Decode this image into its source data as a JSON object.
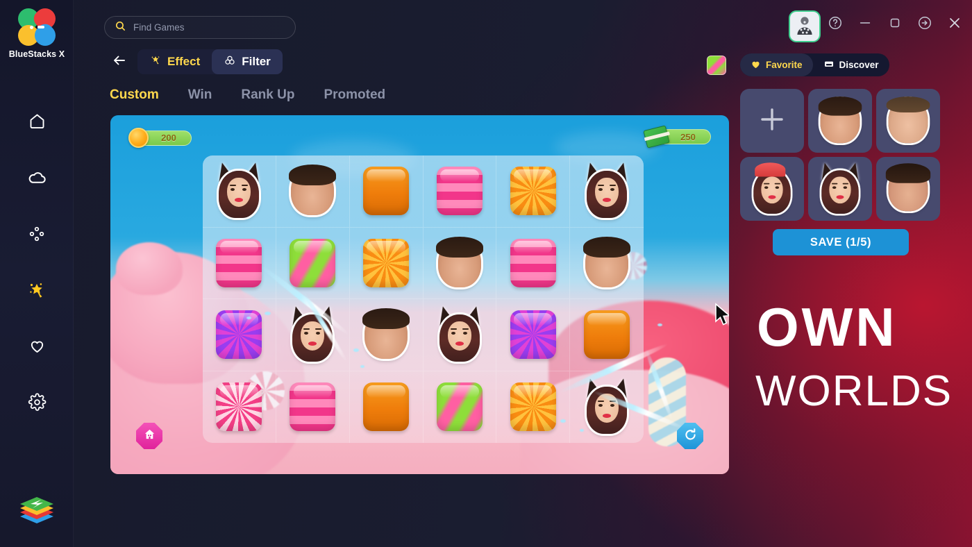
{
  "app": {
    "brand_name": "BlueStacks X",
    "logo_icon": "bluestacks-petals-logo"
  },
  "search": {
    "placeholder": "Find Games",
    "value": "",
    "icon": "search-icon"
  },
  "window_controls": [
    {
      "name": "help-button",
      "icon": "question-circle-icon"
    },
    {
      "name": "minimize-button",
      "icon": "minimize-icon"
    },
    {
      "name": "maximize-button",
      "icon": "maximize-square-icon"
    },
    {
      "name": "popout-button",
      "icon": "arrow-right-circle-icon"
    },
    {
      "name": "close-button",
      "icon": "close-x-icon"
    }
  ],
  "profile": {
    "name": "profile-avatar-button",
    "icon": "user-silhouette-icon"
  },
  "sidebar": {
    "items": [
      {
        "name": "sidebar-item-home",
        "icon": "home-icon",
        "active": false
      },
      {
        "name": "sidebar-item-cloud",
        "icon": "cloud-icon",
        "active": false
      },
      {
        "name": "sidebar-item-apps",
        "icon": "four-dots-icon",
        "active": false
      },
      {
        "name": "sidebar-item-magic",
        "icon": "magic-star-icon",
        "active": true
      },
      {
        "name": "sidebar-item-favorite",
        "icon": "heart-icon",
        "active": false
      },
      {
        "name": "sidebar-item-settings",
        "icon": "gear-icon",
        "active": false
      }
    ],
    "bottom_logo": "bluestacks-stack-logo"
  },
  "toolbar": {
    "back_icon": "arrow-left-icon",
    "effect_label": "Effect",
    "effect_icon": "magic-wand-icon",
    "filter_label": "Filter",
    "filter_icon": "three-circles-icon",
    "filter_active": true
  },
  "right_toolbar": {
    "game_thumb_icon": "candy-game-thumbnail",
    "favorite_label": "Favorite",
    "favorite_icon": "heart-filled-icon",
    "favorite_active": true,
    "discover_label": "Discover",
    "discover_icon": "store-icon"
  },
  "tabs": [
    {
      "label": "Custom",
      "active": true
    },
    {
      "label": "Win",
      "active": false
    },
    {
      "label": "Rank Up",
      "active": false
    },
    {
      "label": "Promoted",
      "active": false
    }
  ],
  "game": {
    "hud": {
      "coins_value": "200",
      "coins_icon": "gold-coin-icon",
      "cash_value": "250",
      "cash_icon": "money-stack-icon"
    },
    "home_button_icon": "house-icon",
    "undo_button_icon": "undo-arrow-icon",
    "cursor_icon": "mouse-cursor-icon",
    "board": {
      "columns": 6,
      "rows": 4,
      "tiles": [
        [
          "catgirl",
          "face-tom",
          "orange-square",
          "pink-stripe",
          "orange-swirl",
          "catgirl"
        ],
        [
          "pink-stripe",
          "green-pink-swirl",
          "orange-swirl",
          "face-tom",
          "pink-stripe",
          "face-tom"
        ],
        [
          "purple-swirl",
          "catgirl",
          "face-tom",
          "catgirl",
          "purple-swirl",
          "orange-square"
        ],
        [
          "pink-swirl",
          "pink-stripe",
          "orange-square",
          "green-pink-swirl",
          "orange-swirl",
          "catgirl"
        ]
      ]
    }
  },
  "right_panel": {
    "add_button_icon": "plus-icon",
    "avatars": [
      {
        "name": "avatar-slot-add",
        "type": "add"
      },
      {
        "name": "avatar-slot-tom",
        "type": "face-tom"
      },
      {
        "name": "avatar-slot-tobey",
        "type": "face-tobey"
      },
      {
        "name": "avatar-slot-redhat",
        "type": "girl-redhat"
      },
      {
        "name": "avatar-slot-catgirl",
        "type": "catgirl"
      },
      {
        "name": "avatar-slot-andrew",
        "type": "face-andrew"
      }
    ],
    "save_label": "SAVE  (1/5)",
    "brand_line1": "OWN",
    "brand_line2": "WORLDS"
  },
  "colors": {
    "accent_yellow": "#ffd84d",
    "accent_blue": "#1d92d6",
    "profile_border_green": "#3fcf8e",
    "background_navy": "#171a2c",
    "background_crimson": "#8e1232"
  }
}
